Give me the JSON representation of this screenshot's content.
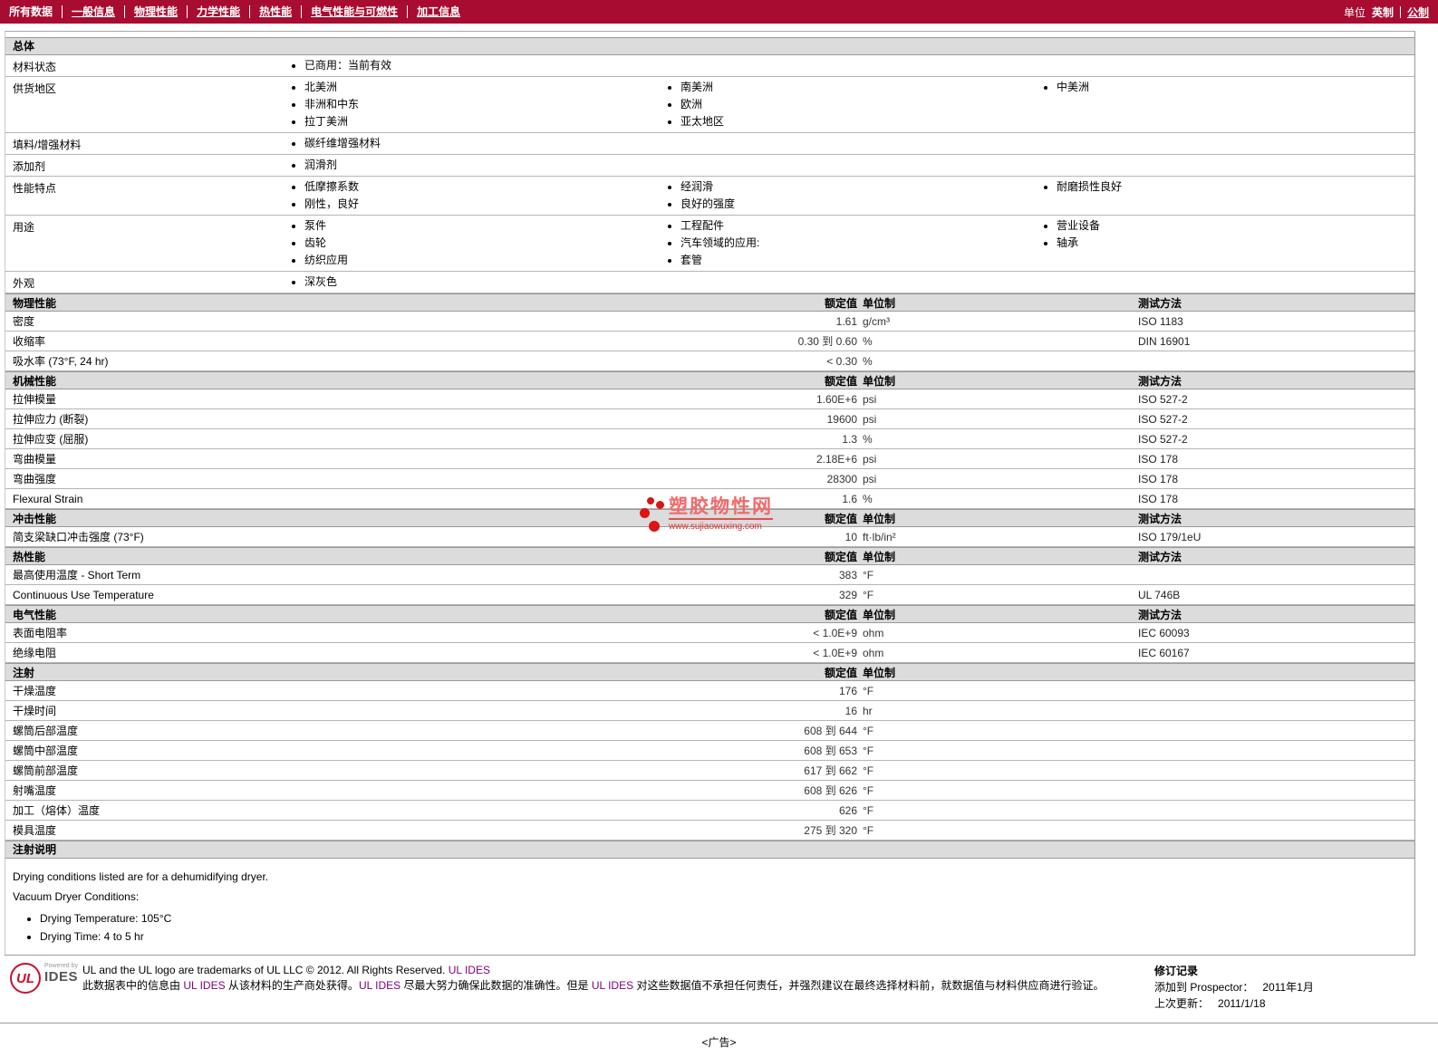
{
  "colors": {
    "nav_bg": "#a80c30",
    "section_header_bg": "#dcdcdc",
    "watermark_red": "#e03030",
    "link_purple": "#800080",
    "ul_red": "#c8102e"
  },
  "nav": {
    "tabs": [
      {
        "label": "所有数据",
        "active": true
      },
      {
        "label": "一般信息",
        "active": false
      },
      {
        "label": "物理性能",
        "active": false
      },
      {
        "label": "力学性能",
        "active": false
      },
      {
        "label": "热性能",
        "active": false
      },
      {
        "label": "电气性能与可燃性",
        "active": false
      },
      {
        "label": "加工信息",
        "active": false
      }
    ],
    "units_label": "单位",
    "unit_english": "英制",
    "unit_metric": "公制"
  },
  "general": {
    "title": "总体",
    "rows": [
      {
        "label": "材料状态",
        "c1": [
          "已商用：当前有效"
        ],
        "c2": [],
        "c3": []
      },
      {
        "label": "供货地区",
        "c1": [
          "北美洲",
          "非洲和中东",
          "拉丁美洲"
        ],
        "c2": [
          "南美洲",
          "欧洲",
          "亚太地区"
        ],
        "c3": [
          "中美洲"
        ]
      },
      {
        "label": "填料/增强材料",
        "c1": [
          "碳纤维增强材料"
        ],
        "c2": [],
        "c3": []
      },
      {
        "label": "添加剂",
        "c1": [
          "润滑剂"
        ],
        "c2": [],
        "c3": []
      },
      {
        "label": "性能特点",
        "c1": [
          "低摩擦系数",
          "刚性，良好"
        ],
        "c2": [
          "经润滑",
          "良好的强度"
        ],
        "c3": [
          "耐磨损性良好"
        ]
      },
      {
        "label": "用途",
        "c1": [
          "泵件",
          "齿轮",
          "纺织应用"
        ],
        "c2": [
          "工程配件",
          "汽车领域的应用:",
          "套管"
        ],
        "c3": [
          "营业设备",
          "轴承"
        ]
      },
      {
        "label": "外观",
        "c1": [
          "深灰色"
        ],
        "c2": [],
        "c3": []
      }
    ]
  },
  "sections": {
    "physical": {
      "title": "物理性能",
      "headers": {
        "value": "额定值",
        "unit": "单位制",
        "method": "测试方法"
      },
      "rows": [
        {
          "label": "密度",
          "value": "1.61",
          "unit": "g/cm³",
          "method": "ISO 1183"
        },
        {
          "label": "收缩率",
          "value": "0.30 到  0.60",
          "unit": "%",
          "method": "DIN 16901"
        },
        {
          "label": "吸水率  (73°F, 24 hr)",
          "value": "< 0.30",
          "unit": "%",
          "method": ""
        }
      ]
    },
    "mechanical": {
      "title": "机械性能",
      "headers": {
        "value": "额定值",
        "unit": "单位制",
        "method": "测试方法"
      },
      "rows": [
        {
          "label": "拉伸模量",
          "value": "1.60E+6",
          "unit": "psi",
          "method": "ISO 527-2"
        },
        {
          "label": "拉伸应力  (断裂)",
          "value": "19600",
          "unit": "psi",
          "method": "ISO 527-2"
        },
        {
          "label": "拉伸应变  (屈服)",
          "value": "1.3",
          "unit": "%",
          "method": "ISO 527-2"
        },
        {
          "label": "弯曲模量",
          "value": "2.18E+6",
          "unit": "psi",
          "method": "ISO 178"
        },
        {
          "label": "弯曲强度",
          "value": "28300",
          "unit": "psi",
          "method": "ISO 178"
        },
        {
          "label": "Flexural Strain",
          "value": "1.6",
          "unit": "%",
          "method": "ISO 178"
        }
      ]
    },
    "impact": {
      "title": "冲击性能",
      "headers": {
        "value": "额定值",
        "unit": "单位制",
        "method": "测试方法"
      },
      "rows": [
        {
          "label": "简支梁缺口冲击强度  (73°F)",
          "value": "10",
          "unit": "ft·lb/in²",
          "method": "ISO 179/1eU"
        }
      ]
    },
    "thermal": {
      "title": "热性能",
      "headers": {
        "value": "额定值",
        "unit": "单位制",
        "method": "测试方法"
      },
      "rows": [
        {
          "label": "最高使用温度  - Short Term",
          "value": "383",
          "unit": "°F",
          "method": ""
        },
        {
          "label": "Continuous Use Temperature",
          "value": "329",
          "unit": "°F",
          "method": "UL 746B"
        }
      ]
    },
    "electrical": {
      "title": "电气性能",
      "headers": {
        "value": "额定值",
        "unit": "单位制",
        "method": "测试方法"
      },
      "rows": [
        {
          "label": "表面电阻率",
          "value": "< 1.0E+9",
          "unit": "ohm",
          "method": "IEC 60093"
        },
        {
          "label": "绝缘电阻",
          "value": "< 1.0E+9",
          "unit": "ohm",
          "method": "IEC 60167"
        }
      ]
    },
    "injection": {
      "title": "注射",
      "headers": {
        "value": "额定值",
        "unit": "单位制",
        "method": ""
      },
      "rows": [
        {
          "label": "干燥温度",
          "value": "176",
          "unit": "°F",
          "method": ""
        },
        {
          "label": "干燥时间",
          "value": "16",
          "unit": "hr",
          "method": ""
        },
        {
          "label": "螺筒后部温度",
          "value": "608 到  644",
          "unit": "°F",
          "method": ""
        },
        {
          "label": "螺筒中部温度",
          "value": "608 到  653",
          "unit": "°F",
          "method": ""
        },
        {
          "label": "螺筒前部温度",
          "value": "617 到  662",
          "unit": "°F",
          "method": ""
        },
        {
          "label": "射嘴温度",
          "value": "608 到  626",
          "unit": "°F",
          "method": ""
        },
        {
          "label": "加工（熔体）温度",
          "value": "626",
          "unit": "°F",
          "method": ""
        },
        {
          "label": "模具温度",
          "value": "275 到  320",
          "unit": "°F",
          "method": ""
        }
      ]
    }
  },
  "notes": {
    "title": "注射说明",
    "lines": [
      "Drying conditions listed are for a dehumidifying dryer.",
      "Vacuum Dryer Conditions:"
    ],
    "bullets": [
      "Drying Temperature: 105°C",
      "Drying Time: 4 to 5 hr"
    ]
  },
  "watermark": {
    "name": "塑胶物性网",
    "url": "www.sujiaowuxing.com"
  },
  "footer": {
    "ul_logo": "UL",
    "powered_by": "Powered by",
    "ides": "IDES",
    "trademark_text": "UL and the UL logo are trademarks of UL LLC © 2012. All Rights Reserved. ",
    "trademark_link": "UL IDES",
    "disclaimer": {
      "p1": "此数据表中的信息由  ",
      "l1": "UL IDES",
      "p2": " 从该材料的生产商处获得。",
      "l2": "UL IDES",
      "p3": " 尽最大努力确保此数据的准确性。但是  ",
      "l3": "UL IDES",
      "p4": " 对这些数据值不承担任何责任，并强烈建议在最终选择材料前，就数据值与材料供应商进行验证。"
    },
    "revision": {
      "title": "修订记录",
      "rows": [
        {
          "label": "添加到  Prospector：",
          "value": "2011年1月"
        },
        {
          "label": "上次更新：",
          "value": "2011/1/18"
        }
      ]
    }
  },
  "ad": {
    "label": "<广告>"
  }
}
